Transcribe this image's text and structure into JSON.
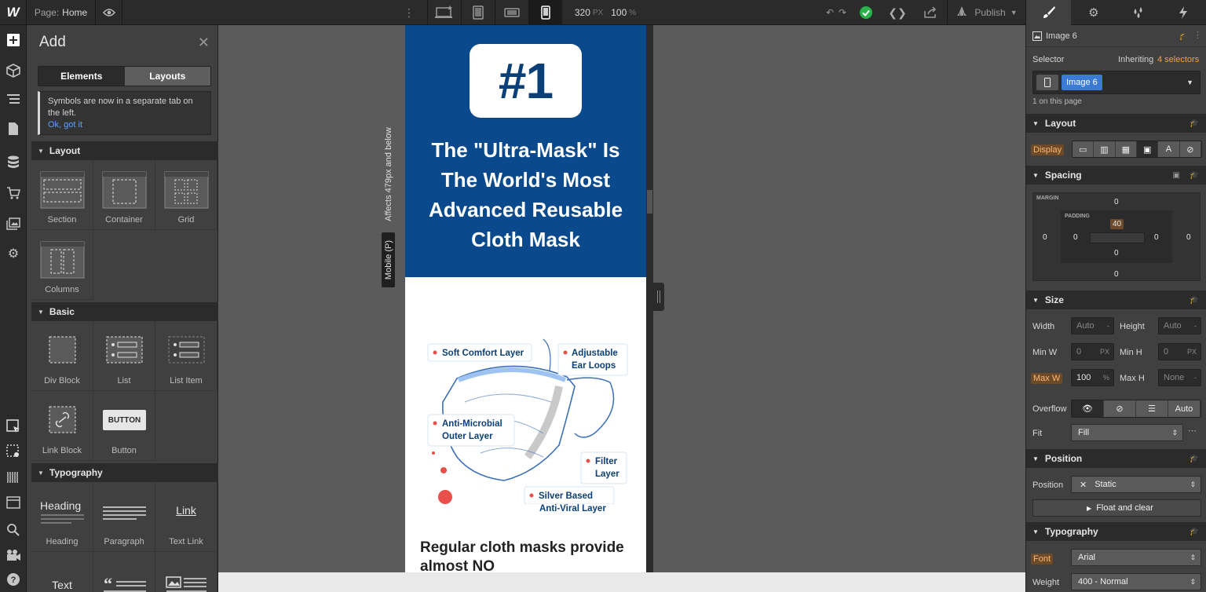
{
  "topbar": {
    "logo": "W",
    "page_key": "Page:",
    "page_value": "Home",
    "viewport_width": "320",
    "viewport_width_unit": "PX",
    "zoom": "100",
    "zoom_unit": "%",
    "publish_label": "Publish"
  },
  "add_panel": {
    "title": "Add",
    "tabs": [
      "Elements",
      "Layouts"
    ],
    "notice_text": "Symbols are now in a separate tab on the left.",
    "notice_link": "Ok, got it",
    "sections": {
      "layout": "Layout",
      "basic": "Basic",
      "typography": "Typography"
    },
    "layout_items": [
      "Section",
      "Container",
      "Grid",
      "Columns"
    ],
    "basic_items": [
      "Div Block",
      "List",
      "List Item",
      "Link Block",
      "Button"
    ],
    "button_preview": "BUTTON",
    "typography_items": [
      "Heading",
      "Paragraph",
      "Text Link",
      "Text"
    ],
    "heading_preview": "Heading",
    "link_preview": "Link"
  },
  "canvas": {
    "breakpoint_affects": "Affects 479px and below",
    "breakpoint_name": "Mobile (P)",
    "badge": "#1",
    "hero_title": "The \"Ultra-Mask\" Is The World's Most Advanced Reusable Cloth Mask",
    "diagram_labels": {
      "soft": "Soft Comfort Layer",
      "ear1": "Adjustable",
      "ear2": "Ear Loops",
      "anti1": "Anti-Microbial",
      "anti2": "Outer Layer",
      "filter1": "Filter",
      "filter2": "Layer",
      "silver1": "Silver Based",
      "silver2": "Anti-Viral Layer"
    },
    "body_text": "Regular cloth masks provide almost NO"
  },
  "right_panel": {
    "element_name": "Image 6",
    "selector_label": "Selector",
    "inheriting_prefix": "Inheriting",
    "inheriting_link": "4 selectors",
    "selector_chip": "Image 6",
    "on_page": "1 on this page",
    "layout_title": "Layout",
    "display_label": "Display",
    "spacing_title": "Spacing",
    "margin_label": "MARGIN",
    "padding_label": "PADDING",
    "margin": {
      "top": "0",
      "right": "0",
      "bottom": "0",
      "left": "0"
    },
    "padding": {
      "top": "40",
      "right": "0",
      "bottom": "0",
      "left": "0"
    },
    "size_title": "Size",
    "width_label": "Width",
    "width_value": "Auto",
    "width_unit": "-",
    "height_label": "Height",
    "height_value": "Auto",
    "height_unit": "-",
    "minw_label": "Min W",
    "minw_value": "0",
    "minw_unit": "PX",
    "minh_label": "Min H",
    "minh_value": "0",
    "minh_unit": "PX",
    "maxw_label": "Max W",
    "maxw_value": "100",
    "maxw_unit": "%",
    "maxh_label": "Max H",
    "maxh_value": "None",
    "maxh_unit": "-",
    "overflow_label": "Overflow",
    "overflow_auto": "Auto",
    "fit_label": "Fit",
    "fit_value": "Fill",
    "position_title": "Position",
    "position_label": "Position",
    "position_value": "Static",
    "float_label": "Float and clear",
    "typography_title": "Typography",
    "font_label": "Font",
    "font_value": "Arial",
    "weight_label": "Weight",
    "weight_value": "400 - Normal"
  },
  "colors": {
    "hero_blue": "#0a4a8c",
    "accent_blue": "#3b7bd6",
    "highlight_orange": "#ffb870",
    "success_green": "#2ab24a"
  }
}
